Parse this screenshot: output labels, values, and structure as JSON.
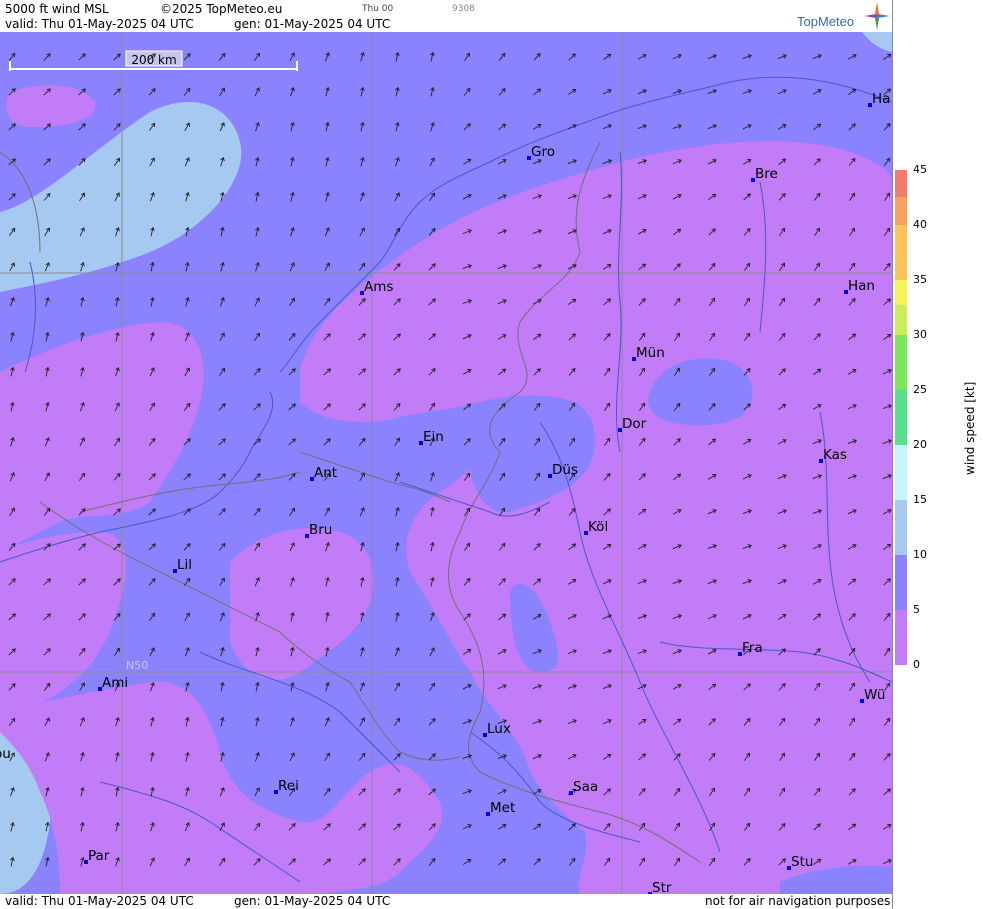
{
  "header": {
    "title": "5000 ft wind MSL",
    "copyright": "©2025 TopMeteo.eu",
    "timecode": "Thu 00",
    "number": "9308",
    "valid": "valid:  Thu  01-May-2025  04 UTC",
    "gen": "gen: 01-May-2025 04 UTC",
    "logo": "TopMeteo"
  },
  "footer": {
    "valid": "valid:  Thu  01-May-2025  04 UTC",
    "gen": "gen: 01-May-2025 04 UTC",
    "disclaimer": "not for air navigation purposes"
  },
  "map": {
    "scale_label": "200 km",
    "lat_label": "N50",
    "cities": [
      {
        "name": "Ha"
      },
      {
        "name": "Gro"
      },
      {
        "name": "Bre"
      },
      {
        "name": "Ams"
      },
      {
        "name": "Han"
      },
      {
        "name": "Mün"
      },
      {
        "name": "Dor"
      },
      {
        "name": "Ein"
      },
      {
        "name": "Kas"
      },
      {
        "name": "Düs"
      },
      {
        "name": "Ant"
      },
      {
        "name": "Köl"
      },
      {
        "name": "Bru"
      },
      {
        "name": "Lil"
      },
      {
        "name": "Fra"
      },
      {
        "name": "Ami"
      },
      {
        "name": "Wü"
      },
      {
        "name": "Lux"
      },
      {
        "name": "ou"
      },
      {
        "name": "Rei"
      },
      {
        "name": "Saa"
      },
      {
        "name": "Met"
      },
      {
        "name": "Stu"
      },
      {
        "name": "Par"
      },
      {
        "name": "Str"
      }
    ]
  },
  "legend": {
    "title": "wind speed [kt]",
    "ticks": [
      "45",
      "40",
      "35",
      "30",
      "25",
      "20",
      "15",
      "10",
      "5",
      "0"
    ],
    "colors": [
      "#f27d6a",
      "#f5a35e",
      "#fbc45a",
      "#f6f35a",
      "#c8ef5a",
      "#7ee65a",
      "#5ae08c",
      "#c2f6f8",
      "#a6c9f2",
      "#8a82ff",
      "#c27cf8"
    ]
  }
}
